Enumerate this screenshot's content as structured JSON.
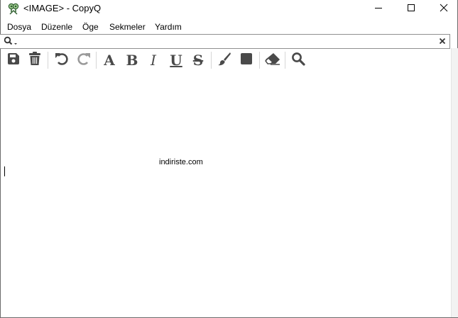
{
  "window": {
    "title": "<IMAGE> - CopyQ",
    "controls": {
      "minimize_icon": "minimize-icon",
      "maximize_icon": "maximize-icon",
      "close_icon": "close-icon"
    }
  },
  "menu": {
    "items": [
      "Dosya",
      "Düzenle",
      "Öge",
      "Sekmeler",
      "Yardım"
    ]
  },
  "search": {
    "value": "",
    "placeholder": ""
  },
  "toolbar": {
    "buttons": [
      "save-icon",
      "trash-icon",
      "undo-icon",
      "redo-icon",
      "font-icon",
      "bold-icon",
      "italic-icon",
      "underline-icon",
      "strikethrough-icon",
      "foreground-color-icon",
      "background-color-icon",
      "eraser-icon",
      "find-icon"
    ],
    "font_glyph": "A",
    "bold_glyph": "B",
    "italic_glyph": "I",
    "underline_glyph": "U",
    "strike_glyph": "S"
  },
  "content": {
    "image_text": "indiriste.com"
  },
  "colors": {
    "icon": "#4a4a4a",
    "icon_disabled": "#9a9a9a",
    "border": "#8f8f8f"
  }
}
